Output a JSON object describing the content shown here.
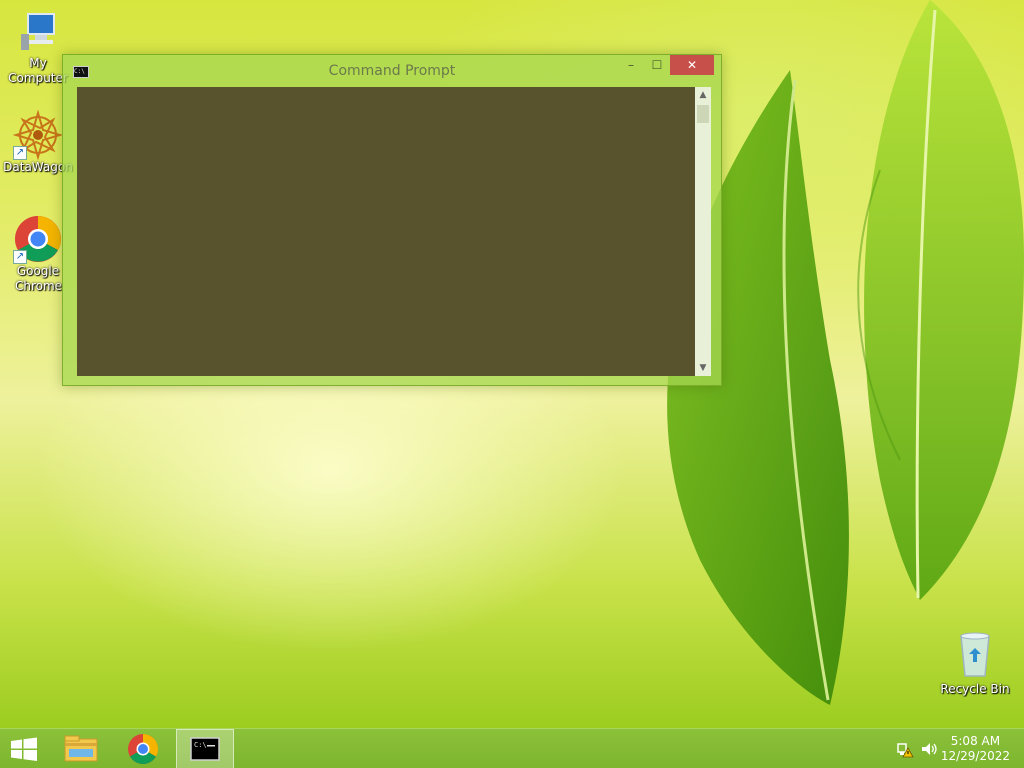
{
  "desktop": {
    "icons": [
      {
        "label": "My Computer"
      },
      {
        "label": "DataWagon"
      },
      {
        "label": "Google Chrome"
      }
    ],
    "recycle_bin": {
      "label": "Recycle Bin"
    }
  },
  "cmd_window": {
    "title": "Command Prompt",
    "app_icon_text": "C:\\",
    "minimize": "–",
    "maximize": "☐",
    "close": "✕"
  },
  "taskbar": {
    "apps": [
      "windows-start-icon",
      "file-explorer-icon",
      "chrome-icon",
      "command-prompt-icon"
    ],
    "clock": {
      "time": "5:08 AM",
      "date": "12/29/2022"
    }
  },
  "colors": {
    "console_bg": "#58532d",
    "window_glass": "#a5d750",
    "close_button": "#c7504a",
    "taskbar": "#8cc13a"
  }
}
